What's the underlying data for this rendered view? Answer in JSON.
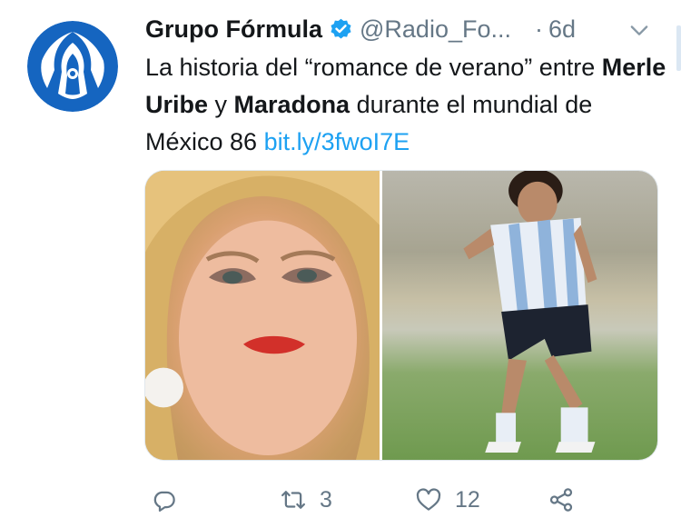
{
  "tweet": {
    "display_name": "Grupo Fórmula",
    "handle": "@Radio_Fo...",
    "separator": "·",
    "time": "6d",
    "text": {
      "part1": "La historia del “romance de verano” entre ",
      "name1": "Merle Uribe",
      "part2": " y ",
      "name2": "Maradona",
      "part3": " durante el mundial de México 86 ",
      "link": "bit.ly/3fwoI7E"
    },
    "actions": {
      "reply_count": "",
      "retweet_count": "3",
      "like_count": "12"
    }
  },
  "icons": {
    "avatar": "grupo-formula-logo",
    "verified": "verified-badge-icon",
    "menu": "chevron-down-icon",
    "reply": "reply-icon",
    "retweet": "retweet-icon",
    "like": "heart-icon",
    "share": "share-icon"
  },
  "colors": {
    "brand_blue": "#1565c0",
    "link": "#1da1f2",
    "muted": "#657786",
    "text": "#14171a"
  }
}
